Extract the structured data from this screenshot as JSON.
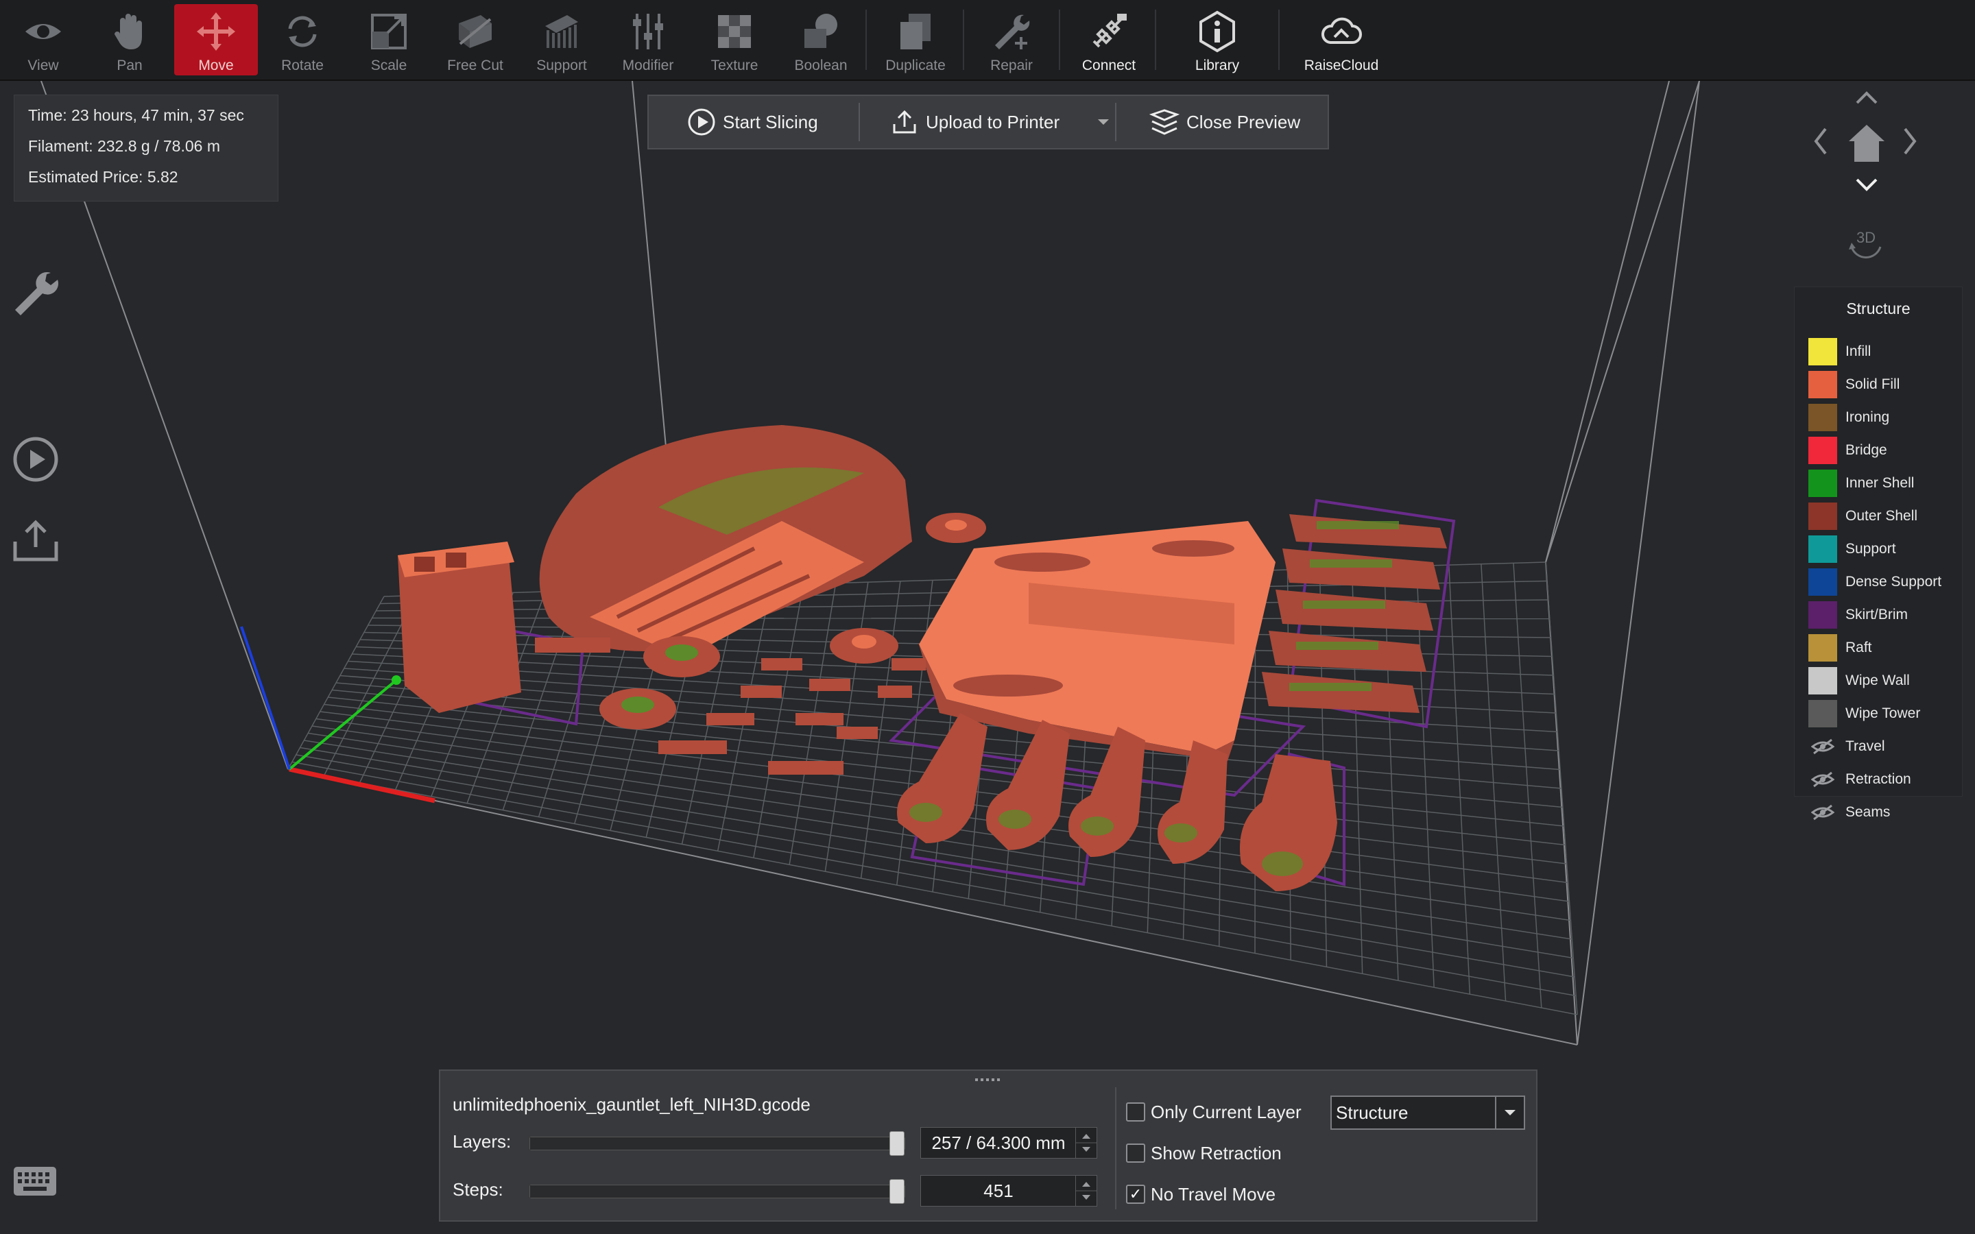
{
  "toolbar": {
    "items": [
      {
        "id": "view",
        "label": "View",
        "icon": "eye-icon"
      },
      {
        "id": "pan",
        "label": "Pan",
        "icon": "hand-icon"
      },
      {
        "id": "move",
        "label": "Move",
        "icon": "move-arrows-icon",
        "active": true
      },
      {
        "id": "rotate",
        "label": "Rotate",
        "icon": "rotate-icon"
      },
      {
        "id": "scale",
        "label": "Scale",
        "icon": "scale-icon"
      },
      {
        "id": "freecut",
        "label": "Free Cut",
        "icon": "cut-icon"
      },
      {
        "id": "support",
        "label": "Support",
        "icon": "support-icon"
      },
      {
        "id": "modifier",
        "label": "Modifier",
        "icon": "sliders-icon"
      },
      {
        "id": "texture",
        "label": "Texture",
        "icon": "checker-icon"
      },
      {
        "id": "boolean",
        "label": "Boolean",
        "icon": "boolean-icon"
      },
      {
        "id": "duplicate",
        "label": "Duplicate",
        "icon": "duplicate-icon"
      },
      {
        "id": "repair",
        "label": "Repair",
        "icon": "wrench-plus-icon"
      },
      {
        "id": "connect",
        "label": "Connect",
        "icon": "connect-icon"
      },
      {
        "id": "library",
        "label": "Library",
        "icon": "info-hex-icon"
      },
      {
        "id": "raisecloud",
        "label": "RaiseCloud",
        "icon": "cloud-icon"
      }
    ],
    "active_color": "#b2121f"
  },
  "info": {
    "time": "Time: 23 hours, 47 min, 37 sec",
    "filament": "Filament: 232.8 g / 78.06 m",
    "price": "Estimated Price: 5.82"
  },
  "actions": {
    "start_slicing": "Start Slicing",
    "upload": "Upload to Printer",
    "close_preview": "Close Preview"
  },
  "nav": {
    "mode_label": "3D"
  },
  "legend": {
    "title": "Structure",
    "items": [
      {
        "label": "Infill",
        "color": "#f1e43a"
      },
      {
        "label": "Solid Fill",
        "color": "#e5603f"
      },
      {
        "label": "Ironing",
        "color": "#7b5527"
      },
      {
        "label": "Bridge",
        "color": "#f0283a"
      },
      {
        "label": "Inner Shell",
        "color": "#14931c"
      },
      {
        "label": "Outer Shell",
        "color": "#8c3528"
      },
      {
        "label": "Support",
        "color": "#0f9a99"
      },
      {
        "label": "Dense Support",
        "color": "#0e4596"
      },
      {
        "label": "Skirt/Brim",
        "color": "#5b2069"
      },
      {
        "label": "Raft",
        "color": "#b89139"
      },
      {
        "label": "Wipe Wall",
        "color": "#c8c8c8"
      },
      {
        "label": "Wipe Tower",
        "color": "#5a5a5a"
      }
    ],
    "hidden_items": [
      {
        "label": "Travel"
      },
      {
        "label": "Retraction"
      },
      {
        "label": "Seams"
      }
    ]
  },
  "preview": {
    "filename": "unlimitedphoenix_gauntlet_left_NIH3D.gcode",
    "layers_label": "Layers:",
    "layers_value": "257 / 64.300 mm",
    "layers_fraction": 1.0,
    "steps_label": "Steps:",
    "steps_value": "451",
    "steps_fraction": 1.0,
    "only_current_layer": "Only Current Layer",
    "only_current_layer_checked": false,
    "show_retraction": "Show Retraction",
    "show_retraction_checked": false,
    "no_travel_move": "No Travel Move",
    "no_travel_move_checked": true,
    "view_mode": "Structure"
  }
}
